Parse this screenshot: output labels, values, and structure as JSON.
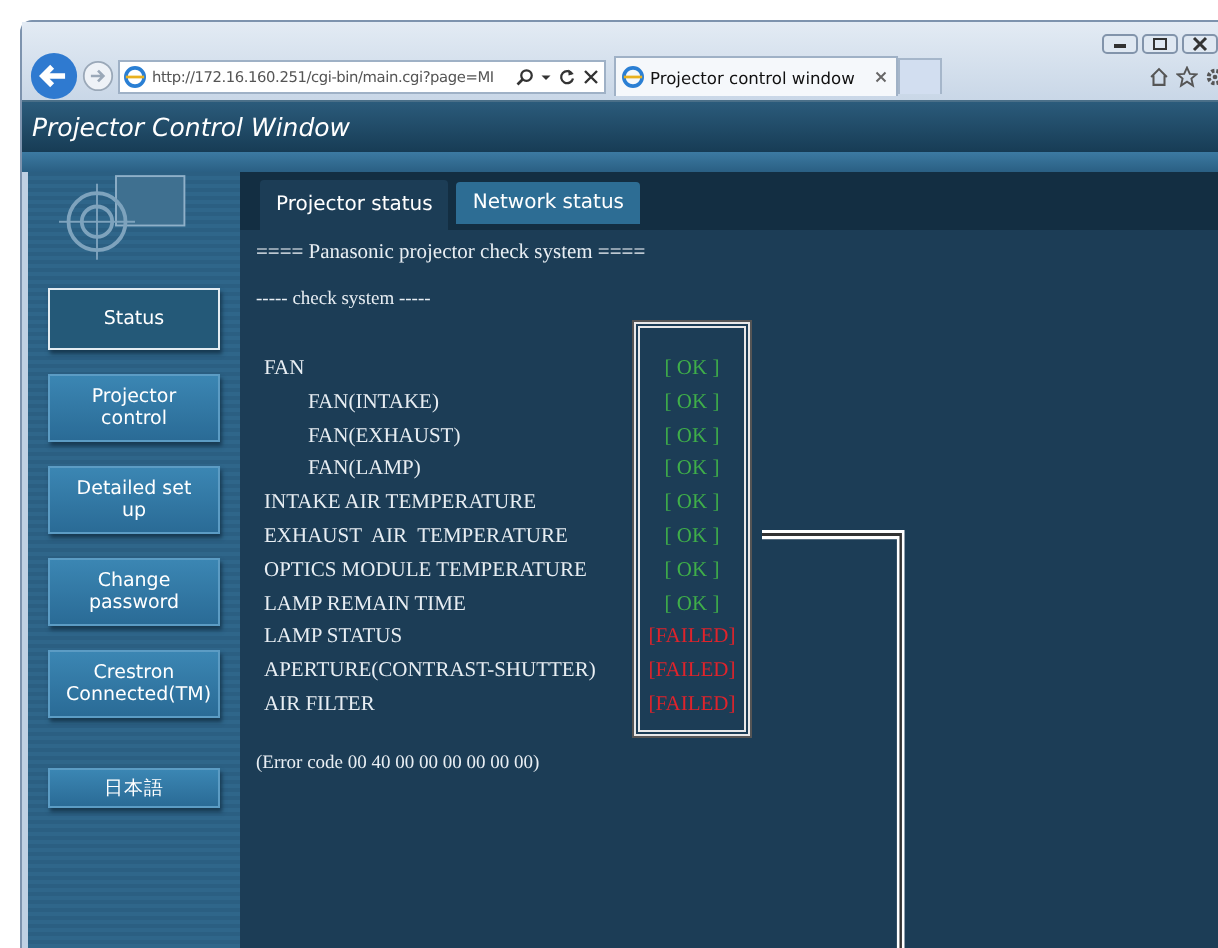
{
  "browser": {
    "address": "http://172.16.160.251/cgi-bin/main.cgi?page=MI",
    "tab_title": "Projector control window"
  },
  "header": {
    "title": "Projector Control Window"
  },
  "sidebar": {
    "items": [
      {
        "label": "Status",
        "selected": true
      },
      {
        "label": "Projector control",
        "selected": false
      },
      {
        "label": "Detailed set up",
        "selected": false
      },
      {
        "label": "Change password",
        "selected": false
      },
      {
        "label": "Crestron Connected(TM)",
        "selected": false
      },
      {
        "label": "日本語",
        "selected": false
      }
    ]
  },
  "tabs": [
    {
      "label": "Projector status",
      "selected": true
    },
    {
      "label": "Network status",
      "selected": false
    }
  ],
  "heading": "==== Panasonic projector check system ====",
  "subheading": "----- check system -----",
  "checks": [
    {
      "label": "FAN",
      "kind": "pass",
      "result": "[ OK ]",
      "children": [
        {
          "label": "FAN(INTAKE)",
          "kind": "pass",
          "result": "[ OK ]"
        },
        {
          "label": "FAN(EXHAUST)",
          "kind": "pass",
          "result": "[ OK ]"
        },
        {
          "label": "FAN(LAMP)",
          "kind": "pass",
          "result": "[ OK ]"
        }
      ]
    },
    {
      "label": "INTAKE AIR TEMPERATURE",
      "kind": "pass",
      "result": "[ OK ]"
    },
    {
      "label": "EXHAUST  AIR  TEMPERATURE",
      "kind": "pass",
      "result": "[ OK ]"
    },
    {
      "label": "OPTICS MODULE TEMPERATURE",
      "kind": "pass",
      "result": "[ OK ]"
    },
    {
      "label": "LAMP REMAIN TIME",
      "kind": "pass",
      "result": "[ OK ]"
    },
    {
      "label": "LAMP STATUS",
      "kind": "fail",
      "result": "[FAILED]"
    },
    {
      "label": "APERTURE(CONTRAST-SHUTTER)",
      "kind": "fail",
      "result": "[FAILED]"
    },
    {
      "label": "AIR FILTER",
      "kind": "fail",
      "result": "[FAILED]"
    }
  ],
  "error_code": "(Error code 00 40 00 00 00 00 00 00)"
}
